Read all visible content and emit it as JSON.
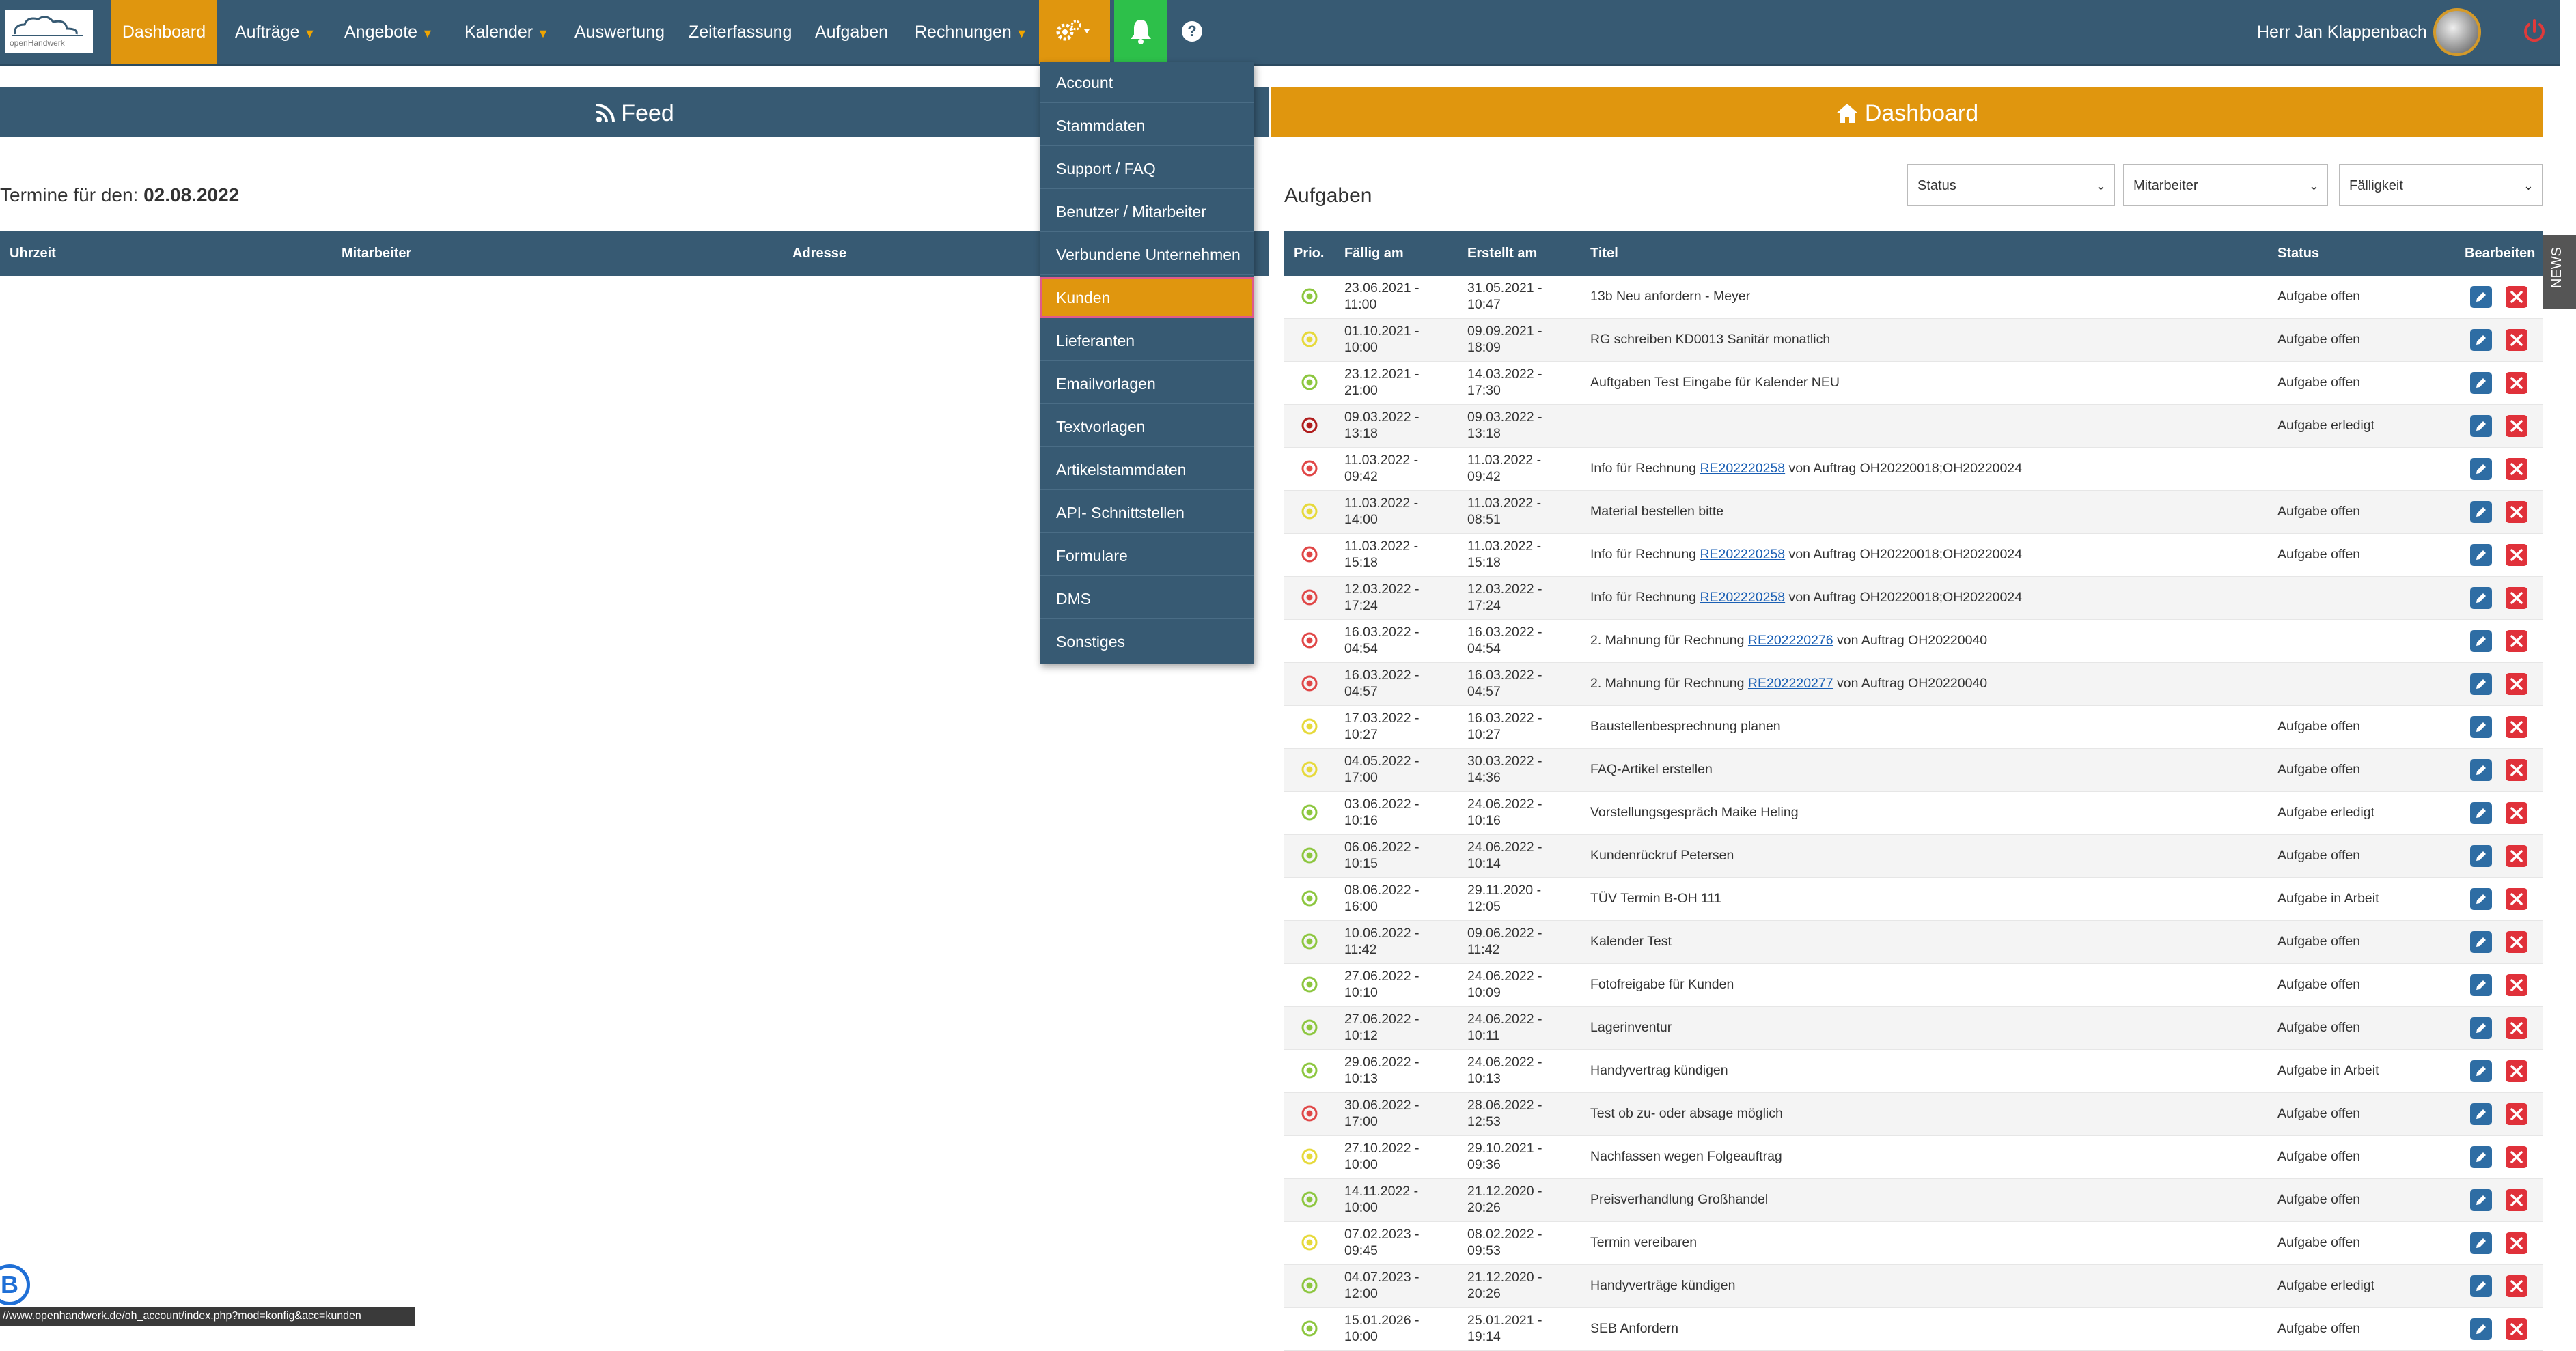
{
  "nav": {
    "logo_text": "openHandwerk",
    "items": [
      {
        "label": "Dashboard",
        "caret": false
      },
      {
        "label": "Aufträge",
        "caret": true
      },
      {
        "label": "Angebote",
        "caret": true
      },
      {
        "label": "Kalender",
        "caret": true
      },
      {
        "label": "Auswertung",
        "caret": false
      },
      {
        "label": "Zeiterfassung",
        "caret": false
      },
      {
        "label": "Aufgaben",
        "caret": false
      },
      {
        "label": "Rechnungen",
        "caret": true
      }
    ],
    "help": "?",
    "user_name": "Herr Jan Klappenbach"
  },
  "tabs": {
    "feed": "Feed",
    "dashboard": "Dashboard"
  },
  "termine": {
    "title_prefix": "Termine für den:",
    "date": "02.08.2022",
    "headers": [
      "Uhrzeit",
      "Mitarbeiter",
      "Adresse"
    ]
  },
  "aufgaben": {
    "title": "Aufgaben",
    "filters": [
      "Status",
      "Mitarbeiter",
      "Fälligkeit"
    ],
    "headers": [
      "Prio.",
      "Fällig am",
      "Erstellt am",
      "Titel",
      "Status",
      "Bearbeiten"
    ],
    "rows": [
      {
        "prio": "green",
        "faellig": [
          "23.06.2021 -",
          "11:00"
        ],
        "erstellt": [
          "31.05.2021 -",
          "10:47"
        ],
        "titel": [
          "13b Neu anfordern - Meyer"
        ],
        "status": "Aufgabe offen"
      },
      {
        "prio": "yellow",
        "faellig": [
          "01.10.2021 -",
          "10:00"
        ],
        "erstellt": [
          "09.09.2021 -",
          "18:09"
        ],
        "titel": [
          "RG schreiben KD0013 Sanitär monatlich"
        ],
        "status": "Aufgabe offen"
      },
      {
        "prio": "green",
        "faellig": [
          "23.12.2021 -",
          "21:00"
        ],
        "erstellt": [
          "14.03.2022 -",
          "17:30"
        ],
        "titel": [
          "Auftgaben Test Eingabe für Kalender NEU"
        ],
        "status": "Aufgabe offen"
      },
      {
        "prio": "darkred",
        "faellig": [
          "09.03.2022 -",
          "13:18"
        ],
        "erstellt": [
          "09.03.2022 -",
          "13:18"
        ],
        "titel": [
          ""
        ],
        "status": "Aufgabe erledigt"
      },
      {
        "prio": "red",
        "faellig": [
          "11.03.2022 -",
          "09:42"
        ],
        "erstellt": [
          "11.03.2022 -",
          "09:42"
        ],
        "titel": [
          "Info für Rechnung ",
          "RE202220258",
          " von Auftrag OH20220018;OH20220024"
        ],
        "status": ""
      },
      {
        "prio": "yellow",
        "faellig": [
          "11.03.2022 -",
          "14:00"
        ],
        "erstellt": [
          "11.03.2022 -",
          "08:51"
        ],
        "titel": [
          "Material bestellen bitte"
        ],
        "status": "Aufgabe offen"
      },
      {
        "prio": "red",
        "faellig": [
          "11.03.2022 -",
          "15:18"
        ],
        "erstellt": [
          "11.03.2022 -",
          "15:18"
        ],
        "titel": [
          "Info für Rechnung ",
          "RE202220258",
          " von Auftrag OH20220018;OH20220024"
        ],
        "status": "Aufgabe offen"
      },
      {
        "prio": "red",
        "faellig": [
          "12.03.2022 -",
          "17:24"
        ],
        "erstellt": [
          "12.03.2022 -",
          "17:24"
        ],
        "titel": [
          "Info für Rechnung ",
          "RE202220258",
          " von Auftrag OH20220018;OH20220024"
        ],
        "status": ""
      },
      {
        "prio": "red",
        "faellig": [
          "16.03.2022 -",
          "04:54"
        ],
        "erstellt": [
          "16.03.2022 -",
          "04:54"
        ],
        "titel": [
          "2. Mahnung für Rechnung ",
          "RE202220276",
          " von Auftrag OH20220040"
        ],
        "status": ""
      },
      {
        "prio": "red",
        "faellig": [
          "16.03.2022 -",
          "04:57"
        ],
        "erstellt": [
          "16.03.2022 -",
          "04:57"
        ],
        "titel": [
          "2. Mahnung für Rechnung ",
          "RE202220277",
          " von Auftrag OH20220040"
        ],
        "status": ""
      },
      {
        "prio": "yellow",
        "faellig": [
          "17.03.2022 -",
          "10:27"
        ],
        "erstellt": [
          "16.03.2022 -",
          "10:27"
        ],
        "titel": [
          "Baustellenbesprechnung planen"
        ],
        "status": "Aufgabe offen"
      },
      {
        "prio": "yellow",
        "faellig": [
          "04.05.2022 -",
          "17:00"
        ],
        "erstellt": [
          "30.03.2022 -",
          "14:36"
        ],
        "titel": [
          "FAQ-Artikel erstellen"
        ],
        "status": "Aufgabe offen"
      },
      {
        "prio": "green",
        "faellig": [
          "03.06.2022 -",
          "10:16"
        ],
        "erstellt": [
          "24.06.2022 -",
          "10:16"
        ],
        "titel": [
          "Vorstellungsgespräch Maike Heling"
        ],
        "status": "Aufgabe erledigt"
      },
      {
        "prio": "green",
        "faellig": [
          "06.06.2022 -",
          "10:15"
        ],
        "erstellt": [
          "24.06.2022 -",
          "10:14"
        ],
        "titel": [
          "Kundenrückruf Petersen"
        ],
        "status": "Aufgabe offen"
      },
      {
        "prio": "green",
        "faellig": [
          "08.06.2022 -",
          "16:00"
        ],
        "erstellt": [
          "29.11.2020 -",
          "12:05"
        ],
        "titel": [
          "TÜV Termin B-OH 111"
        ],
        "status": "Aufgabe in Arbeit"
      },
      {
        "prio": "green",
        "faellig": [
          "10.06.2022 -",
          "11:42"
        ],
        "erstellt": [
          "09.06.2022 -",
          "11:42"
        ],
        "titel": [
          "Kalender Test"
        ],
        "status": "Aufgabe offen"
      },
      {
        "prio": "green",
        "faellig": [
          "27.06.2022 -",
          "10:10"
        ],
        "erstellt": [
          "24.06.2022 -",
          "10:09"
        ],
        "titel": [
          "Fotofreigabe für Kunden"
        ],
        "status": "Aufgabe offen"
      },
      {
        "prio": "green",
        "faellig": [
          "27.06.2022 -",
          "10:12"
        ],
        "erstellt": [
          "24.06.2022 -",
          "10:11"
        ],
        "titel": [
          "Lagerinventur"
        ],
        "status": "Aufgabe offen"
      },
      {
        "prio": "green",
        "faellig": [
          "29.06.2022 -",
          "10:13"
        ],
        "erstellt": [
          "24.06.2022 -",
          "10:13"
        ],
        "titel": [
          "Handyvertrag kündigen"
        ],
        "status": "Aufgabe in Arbeit"
      },
      {
        "prio": "red",
        "faellig": [
          "30.06.2022 -",
          "17:00"
        ],
        "erstellt": [
          "28.06.2022 -",
          "12:53"
        ],
        "titel": [
          "Test ob zu- oder absage möglich"
        ],
        "status": "Aufgabe offen"
      },
      {
        "prio": "yellow",
        "faellig": [
          "27.10.2022 -",
          "10:00"
        ],
        "erstellt": [
          "29.10.2021 -",
          "09:36"
        ],
        "titel": [
          "Nachfassen wegen Folgeauftrag"
        ],
        "status": "Aufgabe offen"
      },
      {
        "prio": "green",
        "faellig": [
          "14.11.2022 -",
          "10:00"
        ],
        "erstellt": [
          "21.12.2020 -",
          "20:26"
        ],
        "titel": [
          "Preisverhandlung Großhandel"
        ],
        "status": "Aufgabe offen"
      },
      {
        "prio": "yellow",
        "faellig": [
          "07.02.2023 -",
          "09:45"
        ],
        "erstellt": [
          "08.02.2022 -",
          "09:53"
        ],
        "titel": [
          "Termin vereibaren"
        ],
        "status": "Aufgabe offen"
      },
      {
        "prio": "green",
        "faellig": [
          "04.07.2023 -",
          "12:00"
        ],
        "erstellt": [
          "21.12.2020 -",
          "20:26"
        ],
        "titel": [
          "Handyverträge kündigen"
        ],
        "status": "Aufgabe erledigt"
      },
      {
        "prio": "green",
        "faellig": [
          "15.01.2026 -",
          "10:00"
        ],
        "erstellt": [
          "25.01.2021 -",
          "19:14"
        ],
        "titel": [
          "SEB Anfordern"
        ],
        "status": "Aufgabe offen"
      }
    ]
  },
  "dropdown": {
    "items": [
      "Account",
      "Stammdaten",
      "Support / FAQ",
      "Benutzer / Mitarbeiter",
      "Verbundene Unternehmen",
      "Kunden",
      "Lieferanten",
      "Emailvorlagen",
      "Textvorlagen",
      "Artikelstammdaten",
      "API- Schnittstellen",
      "Formulare",
      "DMS",
      "Sonstiges"
    ],
    "active": "Kunden"
  },
  "news_label": "NEWS",
  "status_url": "//www.openhandwerk.de/oh_account/index.php?mod=konfig&acc=kunden",
  "bubble_letter": "B",
  "colors": {
    "nav_bg": "#375a73",
    "accent": "#e0960e",
    "bell": "#2dc04a",
    "prio_green": "#8cc63e",
    "prio_yellow": "#e6d93a",
    "prio_red": "#e04646",
    "prio_darkred": "#b01c1c",
    "edit": "#2e6da4",
    "delete": "#e0313a"
  }
}
